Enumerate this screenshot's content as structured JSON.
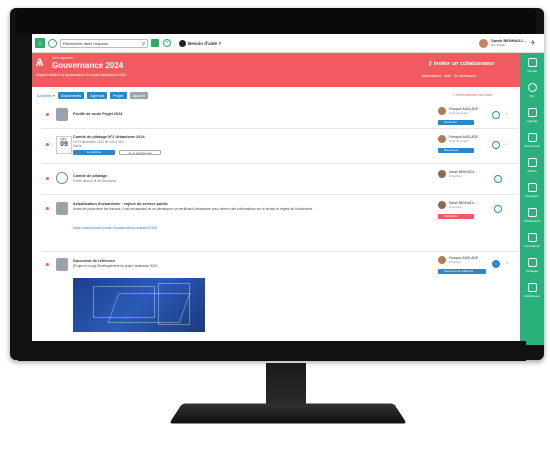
{
  "topbar": {
    "search_placeholder": "Recherche dans l'espace",
    "help_label": "Besoin d'aide ?",
    "user_name": "Sarah BENHADJ...",
    "user_status": "en ligne"
  },
  "header": {
    "breadcrumb": "Mes espaces /",
    "title": "Gouvernance 2024",
    "subtitle": "Espace dédié à la gouvernance du projet Urbanisme 2024",
    "collab_button": "Inviter un collaborateur",
    "options": "Informations  ·  Aide  ·  Se désinscrire"
  },
  "toolbar": {
    "activites": "Activités ▾",
    "buttons": [
      {
        "label": "Documents",
        "color": "#2b88c8"
      },
      {
        "label": "Agenda",
        "color": "#2b88c8"
      },
      {
        "label": "Projet",
        "color": "#2b88c8"
      },
      {
        "label": "Ajouter",
        "color": "#9aa3ab"
      }
    ],
    "notification": "7 informations non lues"
  },
  "sidebar": [
    {
      "label": "Accueil"
    },
    {
      "label": "Fils"
    },
    {
      "label": "Agenda"
    },
    {
      "label": "Documents"
    },
    {
      "label": "Tâches"
    },
    {
      "label": "Sondages"
    },
    {
      "label": "Publications"
    },
    {
      "label": "Formulaires"
    },
    {
      "label": "Partages"
    },
    {
      "label": "Statistiques"
    }
  ],
  "posts": [
    {
      "title": "Feuille de route Projet 2024",
      "author": "François ANGLADE",
      "role": "Chef de projet",
      "tag": "Document",
      "tag_color": "#2b88c8",
      "count": "1"
    },
    {
      "title": "Comité de pilotage N°2 Urbanisme 2024",
      "sub": "Le 09 décembre 2024 de 14h à 16h",
      "sub2": "Mairie",
      "day": "09",
      "month": "DÉC.",
      "btn_primary": "Je participe",
      "btn_secondary": "Je ne participe pas",
      "author": "François ANGLADE",
      "role": "Chef de projet",
      "tag": "Événement",
      "tag_color": "#2b88c8",
      "count": "2"
    },
    {
      "title": "Comité de pilotage",
      "sub": "Publié dans le fil de discussion",
      "author": "Sarah BENHADJ...",
      "role": "Directrice",
      "tag": "",
      "tag_color": "",
      "count": ""
    },
    {
      "title": "Actualisation d'urbanisme : enjeux du service public",
      "body": "Avant de poursuivre les travaux, il est nécessaire de se démarquer un certificat d'urbanisme pour obtenir des informations sur le terrain et règles de l'urbanisme.",
      "body2": "Lien",
      "link": "https://www.service-public.fr/particuliers/vosdroits/F1633",
      "author": "Sarah BENHADJ...",
      "role": "Directrice",
      "tag": "Publication",
      "tag_color": "#f15a5f",
      "count": ""
    },
    {
      "title": "Document de référence",
      "sub": "[Projet en cours] Développement du projet Urbanisme 2024",
      "author": "François ANGLADE",
      "role": "Directeur",
      "tag": "Document de référence",
      "tag_color": "#2b88c8",
      "count": "3"
    }
  ]
}
